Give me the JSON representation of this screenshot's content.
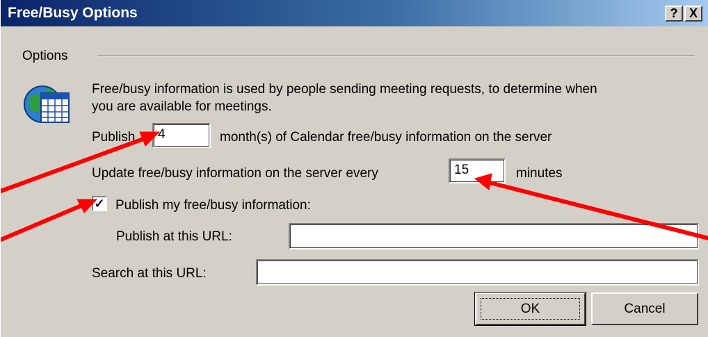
{
  "window": {
    "title": "Free/Busy Options",
    "help_label": "?",
    "close_label": "X"
  },
  "options": {
    "group_label": "Options",
    "description": "Free/busy information is used by people sending meeting requests, to determine when",
    "description_line2": "you are available for meetings.",
    "publish_prefix": "Publish",
    "publish_months_value": "4",
    "publish_suffix": "month(s) of Calendar free/busy information on the server",
    "update_label": "Update free/busy information on the server every",
    "update_minutes_value": "15",
    "minutes_label": "minutes",
    "publish_checkbox_label": "Publish my free/busy information:",
    "publish_checked": true,
    "publish_url_label": "Publish at this URL:",
    "publish_url_value": "",
    "search_url_label": "Search at this URL:",
    "search_url_value": ""
  },
  "buttons": {
    "ok_label": "OK",
    "cancel_label": "Cancel"
  },
  "icons": {
    "calendar": "calendar-globe-icon",
    "check": "checkmark-icon"
  },
  "colors": {
    "titlebar_start": "#0a246a",
    "titlebar_end": "#a6caf0",
    "dialog_bg": "#d4d0c8",
    "annotation_arrow": "#ff0000"
  }
}
